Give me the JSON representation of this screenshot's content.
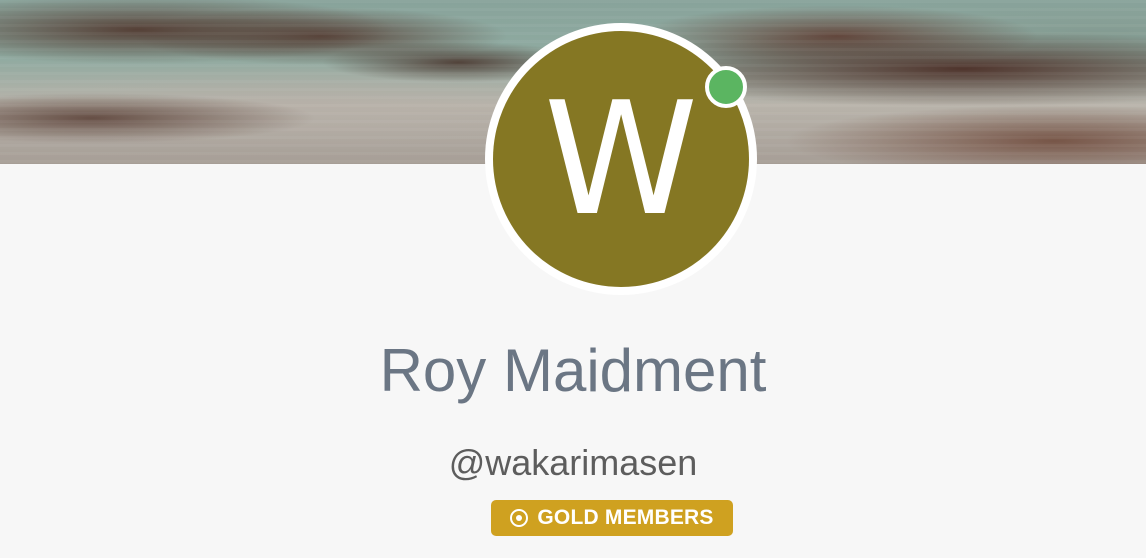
{
  "profile": {
    "cover_image": "rocky coastal landscape",
    "avatar_initial": "W",
    "name": "Roy Maidment",
    "handle": "@wakarimasen",
    "status": "online",
    "badge": {
      "label": "GOLD MEMBERS",
      "icon": "target-icon"
    }
  },
  "colors": {
    "avatar": "#857723",
    "status_online": "#5bb561",
    "badge": "#cfa120",
    "name": "#6b7684",
    "handle": "#5d5d5d",
    "background": "#f7f7f7"
  }
}
